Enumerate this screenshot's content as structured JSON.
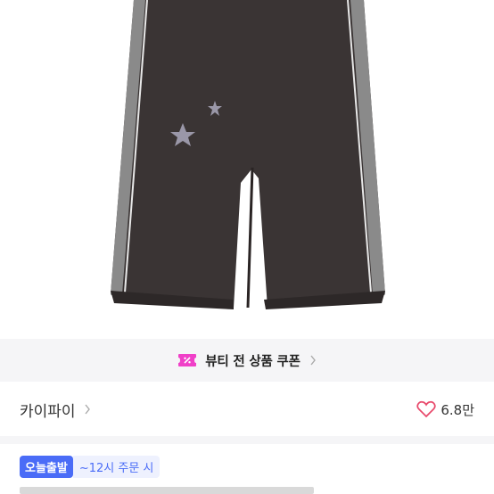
{
  "product": {
    "image_alt": "dark brown wide track pants with grey side stripes and star prints"
  },
  "coupon": {
    "label": "뷰티 전 상품 쿠폰",
    "icon": "ticket-percent-icon",
    "accent": "#f040c8"
  },
  "brand": {
    "name": "카이파이",
    "chevron": "chevron-right-icon"
  },
  "like": {
    "count": "6.8만",
    "icon": "heart-outline-icon",
    "color": "#e8486a"
  },
  "shipping": {
    "badge": "오늘출발",
    "note": "~12시 주문 시",
    "color": "#4a6cf7"
  }
}
